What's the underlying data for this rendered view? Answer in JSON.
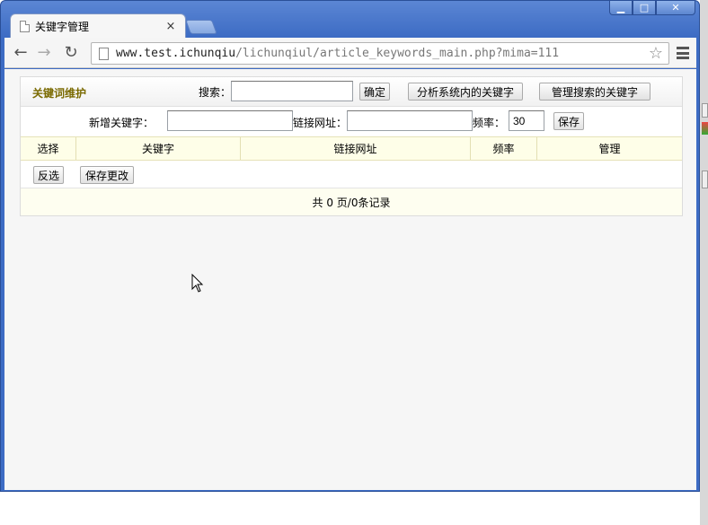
{
  "browser": {
    "tab_title": "关键字管理",
    "tab_close": "×",
    "url_host": "www.test.ichunqiu",
    "url_path": "/lichunqiul/article_keywords_main.php?mima=111",
    "window_min": "▁",
    "window_max": "□",
    "window_close": "✕",
    "back": "←",
    "forward": "→",
    "reload": "↻",
    "star": "☆"
  },
  "panel": {
    "title": "关键词维护",
    "search_label": "搜索：",
    "search_value": "",
    "confirm_button": "确定",
    "analyze_button": "分析系统内的关键字",
    "manage_search_button": "管理搜索的关键字",
    "new_keyword_label": "新增关键字：",
    "new_keyword_value": "",
    "link_url_label": "链接网址：",
    "link_url_value": "",
    "frequency_label": "频率：",
    "frequency_value": "30",
    "save_button": "保存"
  },
  "table": {
    "headers": [
      "选择",
      "关键字",
      "链接网址",
      "频率",
      "管理"
    ],
    "rows": []
  },
  "actions": {
    "invert_select_button": "反选",
    "save_changes_button": "保存更改"
  },
  "footer": {
    "pagination_text": "共 0 页/0条记录"
  }
}
